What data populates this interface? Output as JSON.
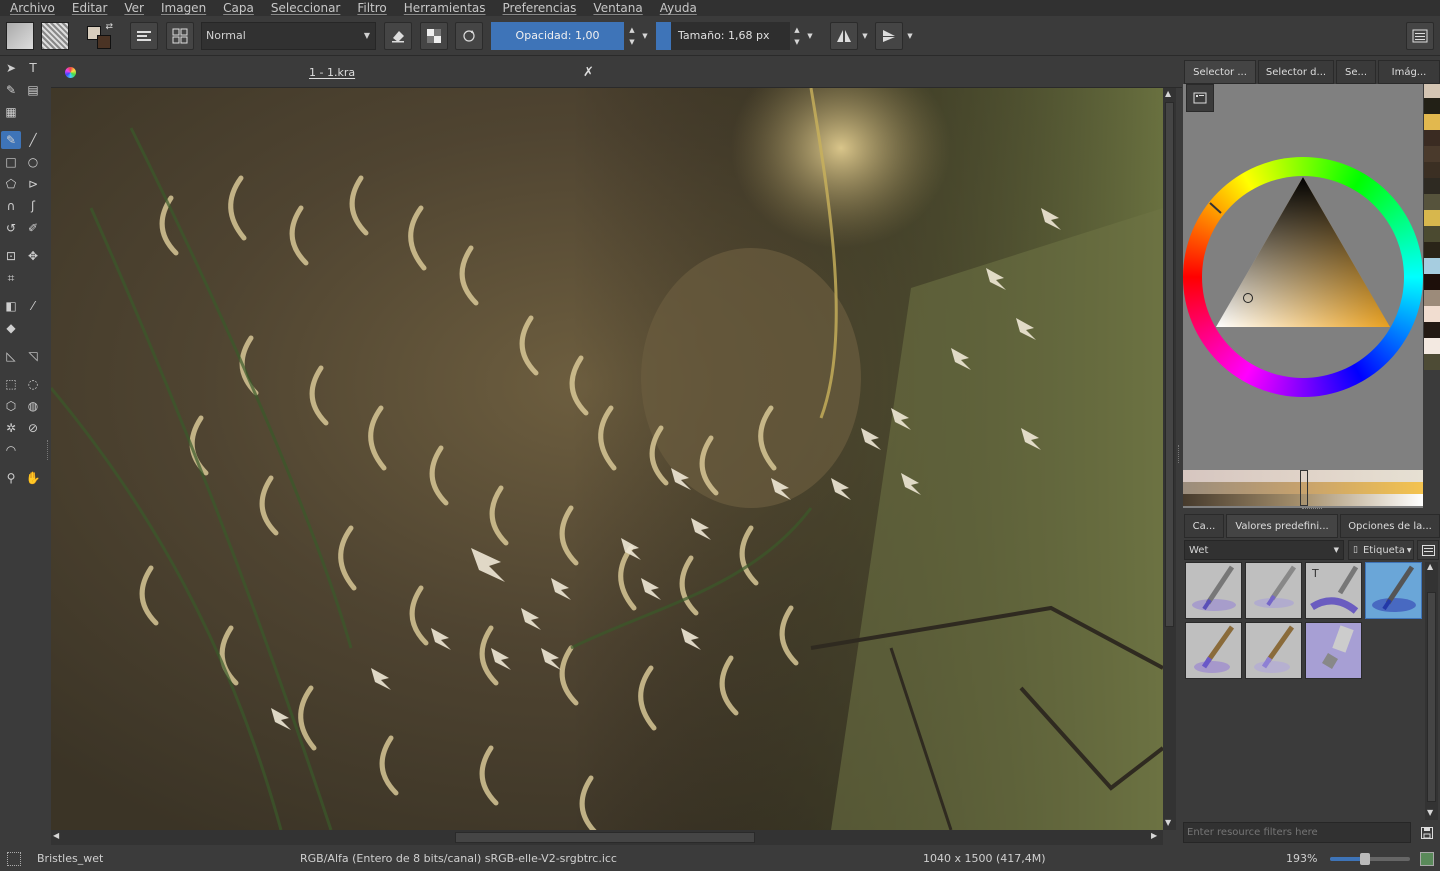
{
  "menu": [
    "Archivo",
    "Editar",
    "Ver",
    "Imagen",
    "Capa",
    "Seleccionar",
    "Filtro",
    "Herramientas",
    "Preferencias",
    "Ventana",
    "Ayuda"
  ],
  "toolbar": {
    "blend_mode": "Normal",
    "opacity_label": "Opacidad:",
    "opacity_value": "1,00",
    "size_label": "Tamaño:",
    "size_value": "1,68 px"
  },
  "document": {
    "tab_title": "1 - 1.kra"
  },
  "right_panel": {
    "top_tabs": [
      "Selector ...",
      "Selector d...",
      "Se...",
      "Imág..."
    ],
    "bottom_tabs": [
      "Ca...",
      "Valores predefini...",
      "Opciones de la..."
    ],
    "preset_filter": "Wet",
    "tag_label": "Etiqueta",
    "resource_filter_placeholder": "Enter resource filters here"
  },
  "status": {
    "brush_name": "Bristles_wet",
    "color_space": "RGB/Alfa (Entero de 8 bits/canal)  sRGB-elle-V2-srgbtrc.icc",
    "image_size": "1040 x 1500 (417,4M)",
    "zoom": "193%"
  },
  "colors": {
    "accent": "#3e74b8",
    "panel": "#3b3b3b",
    "canvas_bg": "#4a4332"
  }
}
